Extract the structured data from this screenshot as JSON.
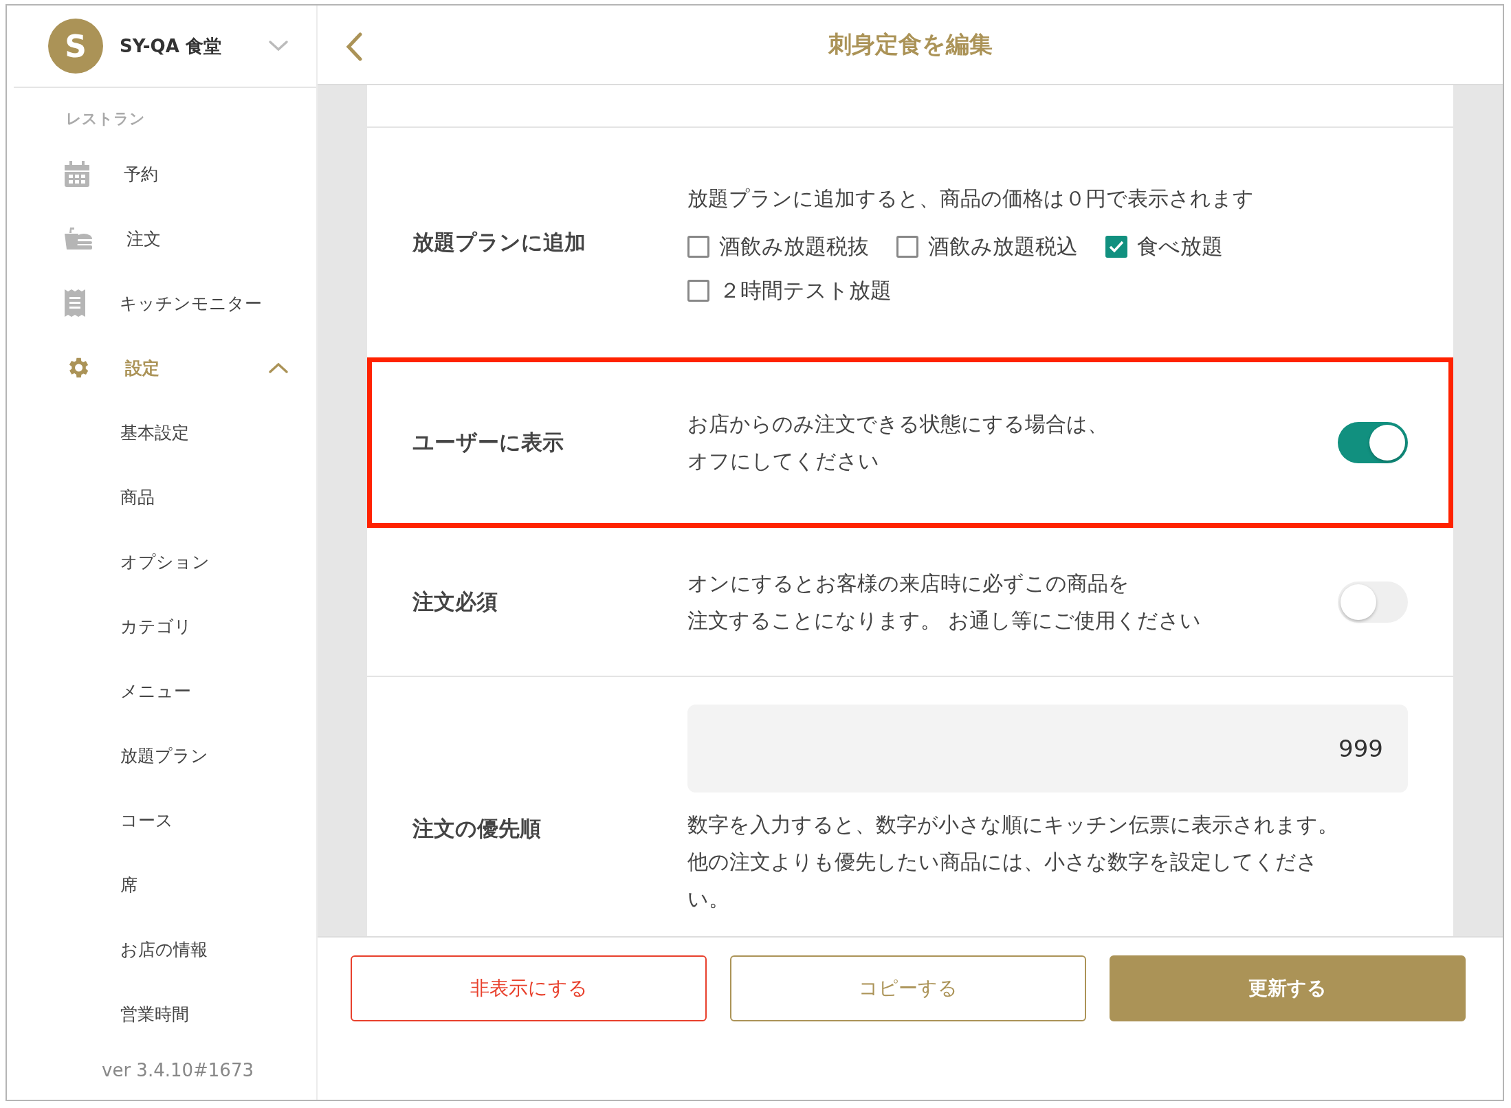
{
  "sidebar": {
    "shop": {
      "avatar": "S",
      "name": "SY-QA 食堂"
    },
    "section_label": "レストラン",
    "items": [
      {
        "label": "予約",
        "selected": false
      },
      {
        "label": "注文",
        "selected": false
      },
      {
        "label": "キッチンモニター",
        "selected": false
      },
      {
        "label": "設定",
        "selected": true,
        "expanded": true,
        "children": [
          {
            "label": "基本設定"
          },
          {
            "label": "商品"
          },
          {
            "label": "オプション"
          },
          {
            "label": "カテゴリ"
          },
          {
            "label": "メニュー"
          },
          {
            "label": "放題プラン"
          },
          {
            "label": "コース"
          },
          {
            "label": "席"
          },
          {
            "label": "お店の情報"
          },
          {
            "label": "営業時間"
          }
        ]
      }
    ],
    "version": "ver 3.4.10#1673"
  },
  "header": {
    "title": "刺身定食を編集"
  },
  "form": {
    "rows": [
      {
        "kind": "checkboxes",
        "label": "放題プランに追加",
        "description": "放題プランに追加すると、商品の価格は０円で表示されます",
        "highlighted": false,
        "options": [
          {
            "label": "酒飲み放題税抜",
            "checked": false
          },
          {
            "label": "酒飲み放題税込",
            "checked": false
          },
          {
            "label": "食べ放題",
            "checked": true
          },
          {
            "label": "２時間テスト放題",
            "checked": false
          }
        ]
      },
      {
        "kind": "toggle",
        "label": "ユーザーに表示",
        "lines": [
          "お店からのみ注文できる状態にする場合は、",
          "オフにしてください"
        ],
        "on": true,
        "highlighted": true
      },
      {
        "kind": "toggle",
        "label": "注文必須",
        "lines": [
          "オンにするとお客様の来店時に必ずこの商品を",
          "注文することになります。 お通し等にご使用ください"
        ],
        "on": false,
        "highlighted": false
      },
      {
        "kind": "number",
        "label": "注文の優先順",
        "value": "999",
        "lines": [
          "数字を入力すると、数字が小さな順にキッチン伝票に表示されます。",
          "他の注文よりも優先したい商品には、小さな数字を設定してくださ",
          "い。"
        ],
        "highlighted": false
      }
    ]
  },
  "footer": {
    "buttons": [
      {
        "label": "非表示にする",
        "kind": "danger"
      },
      {
        "label": "コピーする",
        "kind": "outline"
      },
      {
        "label": "更新する",
        "kind": "primary"
      }
    ]
  }
}
